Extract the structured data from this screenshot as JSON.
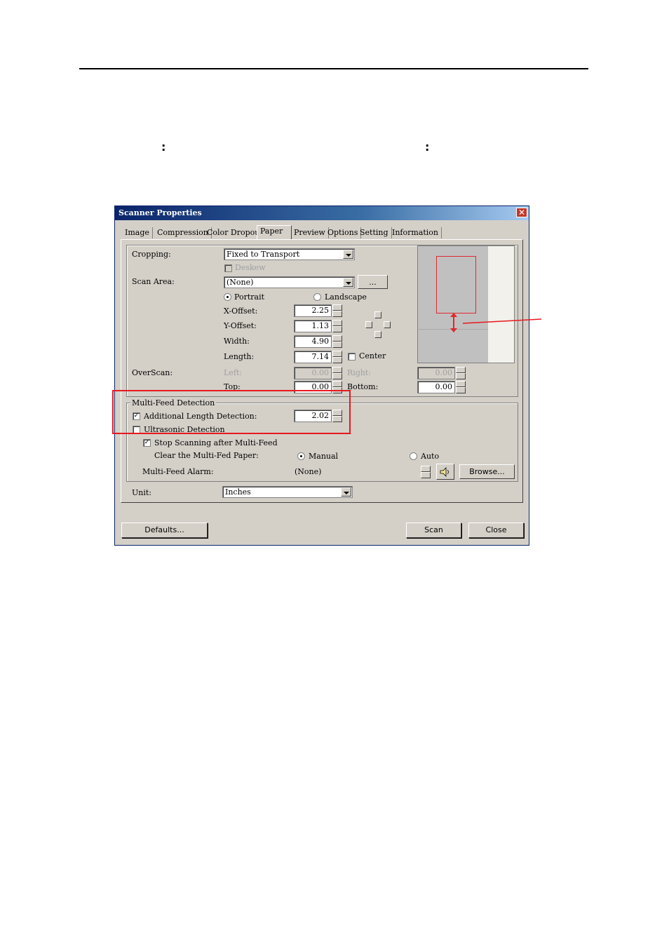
{
  "doc": {
    "colon_1": ":",
    "colon_2": ":"
  },
  "dialog": {
    "title": "Scanner Properties",
    "close_glyph": "✕",
    "tabs": [
      {
        "label": "Image"
      },
      {
        "label": "Compression"
      },
      {
        "label": "Color Dropout"
      },
      {
        "label": "Paper"
      },
      {
        "label": "Preview"
      },
      {
        "label": "Options"
      },
      {
        "label": "Setting"
      },
      {
        "label": "Information"
      }
    ],
    "active_tab": "Paper",
    "cropping": {
      "label": "Cropping:",
      "value": "Fixed to Transport",
      "deskew_label": "Deskew"
    },
    "scan_area": {
      "label": "Scan Area:",
      "value": "(None)",
      "browse_label": "..."
    },
    "orientation": {
      "portrait": "Portrait",
      "landscape": "Landscape",
      "selected": "Portrait"
    },
    "x_offset": {
      "label": "X-Offset:",
      "value": "2.25"
    },
    "y_offset": {
      "label": "Y-Offset:",
      "value": "1.13"
    },
    "width": {
      "label": "Width:",
      "value": "4.90"
    },
    "length": {
      "label": "Length:",
      "value": "7.14"
    },
    "center": {
      "label": "Center",
      "checked": false
    },
    "overscan": {
      "label": "OverScan:",
      "left_label": "Left:",
      "left_value": "0.00",
      "right_label": "Right:",
      "right_value": "0.00",
      "top_label": "Top:",
      "top_value": "0.00",
      "bottom_label": "Bottom:",
      "bottom_value": "0.00"
    },
    "multifeed": {
      "group_label": "Multi-Feed Detection",
      "additional_length_label": "Additional Length Detection:",
      "additional_length_checked": true,
      "additional_length_value": "2.02",
      "ultrasonic_label": "Ultrasonic Detection",
      "ultrasonic_checked": false,
      "stop_label": "Stop Scanning after Multi-Feed",
      "stop_checked": true,
      "clear_label": "Clear the Multi-Fed Paper:",
      "manual_label": "Manual",
      "auto_label": "Auto",
      "clear_selected": "Manual",
      "alarm_label": "Multi-Feed Alarm:",
      "alarm_value": "(None)",
      "browse_label": "Browse..."
    },
    "unit": {
      "label": "Unit:",
      "value": "Inches"
    },
    "buttons": {
      "defaults": "Defaults...",
      "scan": "Scan",
      "close": "Close"
    }
  },
  "colors": {
    "highlight_box": "#e8181f",
    "title_gradient_start": "#0a246a",
    "dialog_bg": "#d4d0c8"
  }
}
